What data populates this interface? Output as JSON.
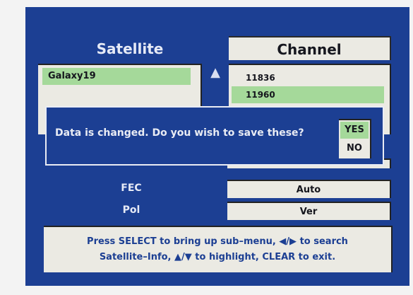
{
  "satellite_panel": {
    "title": "Satellite",
    "selected": "Galaxy19"
  },
  "channel_panel": {
    "title": "Channel",
    "items": [
      "11836",
      "11960"
    ],
    "selected_index": 1
  },
  "scroll_up_glyph": "▲",
  "fields": [
    {
      "label": "FEC",
      "value": "Auto"
    },
    {
      "label": "Pol",
      "value": "Ver"
    }
  ],
  "dialog": {
    "message": "Data is changed. Do you wish to save these?",
    "yes_label": "YES",
    "no_label": "NO"
  },
  "help": {
    "line1": "Press SELECT to bring up sub–menu, ◀/▶ to search",
    "line2": "Satellite–Info, ▲/▼ to highlight, CLEAR to exit."
  },
  "colors": {
    "background": "#1c3f93",
    "highlight": "#a5d99a",
    "panel": "#ebeae3"
  }
}
